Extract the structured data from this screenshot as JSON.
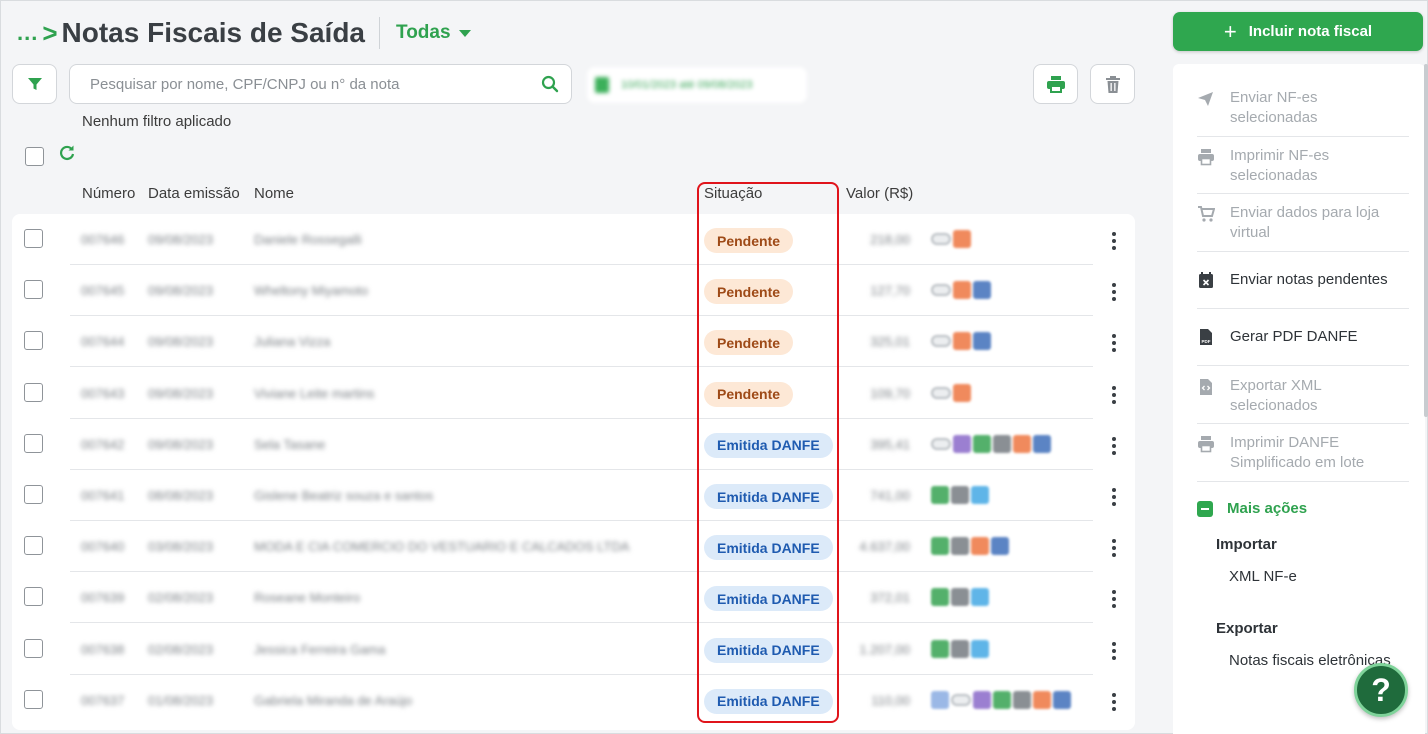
{
  "header": {
    "breadcrumb_dots": "...",
    "breadcrumb_sep": ">",
    "title": "Notas Fiscais de Saída",
    "status_filter": "Todas"
  },
  "toolbar": {
    "search_placeholder": "Pesquisar por nome, CPF/CNPJ ou n° da nota",
    "date_range": "10/01/2023 até 09/08/2023",
    "no_filter": "Nenhum filtro aplicado"
  },
  "table": {
    "columns": {
      "numero": "Número",
      "data": "Data emissão",
      "nome": "Nome",
      "situacao": "Situação",
      "valor": "Valor (R$)"
    },
    "rows": [
      {
        "numero": "007646",
        "data": "09/08/2023",
        "nome": "Daniele Rossegalli",
        "situacao": "Pendente",
        "status": "pend",
        "valor": "218,00"
      },
      {
        "numero": "007645",
        "data": "09/08/2023",
        "nome": "Wheltony Miyamoto",
        "situacao": "Pendente",
        "status": "pend",
        "valor": "127,70"
      },
      {
        "numero": "007644",
        "data": "09/08/2023",
        "nome": "Juliana Vizza",
        "situacao": "Pendente",
        "status": "pend",
        "valor": "325,01"
      },
      {
        "numero": "007643",
        "data": "09/08/2023",
        "nome": "Viviane Leite martins",
        "situacao": "Pendente",
        "status": "pend",
        "valor": "109,70"
      },
      {
        "numero": "007642",
        "data": "09/08/2023",
        "nome": "Sela Tasane",
        "situacao": "Emitida DANFE",
        "status": "emit",
        "valor": "395,41"
      },
      {
        "numero": "007641",
        "data": "08/08/2023",
        "nome": "Gislene Beatriz souza e santos",
        "situacao": "Emitida DANFE",
        "status": "emit",
        "valor": "741,00"
      },
      {
        "numero": "007640",
        "data": "03/08/2023",
        "nome": "MODA E CIA COMERCIO DO VESTUARIO E CALCADOS LTDA",
        "situacao": "Emitida DANFE",
        "status": "emit",
        "valor": "4.637,00"
      },
      {
        "numero": "007639",
        "data": "02/08/2023",
        "nome": "Roseane Monteiro",
        "situacao": "Emitida DANFE",
        "status": "emit",
        "valor": "372,01"
      },
      {
        "numero": "007638",
        "data": "02/08/2023",
        "nome": "Jessica Ferreira Gama",
        "situacao": "Emitida DANFE",
        "status": "emit",
        "valor": "1.207,00"
      },
      {
        "numero": "007637",
        "data": "01/08/2023",
        "nome": "Gabriela Miranda de Araújo",
        "situacao": "Emitida DANFE",
        "status": "emit",
        "valor": "110,00"
      }
    ],
    "row_tags": [
      [
        "pill",
        "#f08a5d"
      ],
      [
        "pill",
        "#f08a5d",
        "#5b84c4"
      ],
      [
        "pill",
        "#f08a5d",
        "#5b84c4"
      ],
      [
        "pill",
        "#f08a5d"
      ],
      [
        "pill",
        "#9b7fd1",
        "#54b06b",
        "#8a8f94",
        "#f08a5d",
        "#5b84c4"
      ],
      [
        "#54b06b",
        "#8a8f94",
        "#5fb5e8"
      ],
      [
        "#54b06b",
        "#8a8f94",
        "#f08a5d",
        "#5b84c4"
      ],
      [
        "#54b06b",
        "#8a8f94",
        "#5fb5e8"
      ],
      [
        "#54b06b",
        "#8a8f94",
        "#5fb5e8"
      ],
      [
        "#9bb8e6",
        "pill",
        "#9b7fd1",
        "#54b06b",
        "#8a8f94",
        "#f08a5d",
        "#5b84c4"
      ]
    ]
  },
  "panel": {
    "add_button": "Incluir nota fiscal",
    "actions": [
      {
        "label": "Enviar NF-es selecionadas",
        "icon": "send-icon",
        "enabled": false
      },
      {
        "label": "Imprimir NF-es selecionadas",
        "icon": "printer-icon",
        "enabled": false
      },
      {
        "label": "Enviar dados para loja virtual",
        "icon": "cart-icon",
        "enabled": false
      },
      {
        "label": "Enviar notas pendentes",
        "icon": "calendar-x-icon",
        "enabled": true
      },
      {
        "label": "Gerar PDF DANFE",
        "icon": "pdf-file-icon",
        "enabled": true
      },
      {
        "label": "Exportar XML selecionados",
        "icon": "xml-file-icon",
        "enabled": false
      },
      {
        "label": "Imprimir DANFE Simplificado em lote",
        "icon": "printer-icon",
        "enabled": false
      }
    ],
    "more_actions": "Mais ações",
    "import_header": "Importar",
    "import_item": "XML NF-e",
    "export_header": "Exportar",
    "export_item": "Notas fiscais eletrônicas",
    "help": "?"
  },
  "colors": {
    "accent": "#2fa74f",
    "pending_bg": "#fde8d6",
    "pending_text": "#9e4a17",
    "emitted_bg": "#dceaf9",
    "emitted_text": "#1f5bb0",
    "highlight": "#e0141b"
  }
}
